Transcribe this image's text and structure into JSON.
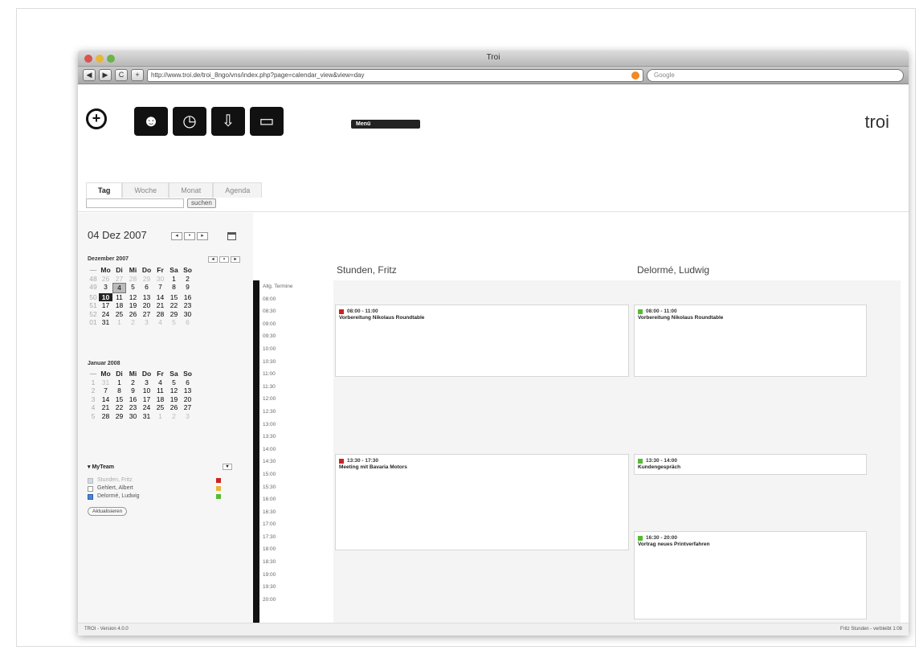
{
  "window": {
    "title": "Troi",
    "url": "http://www.troi.de/troi_8ngo/vns/index.php?page=calendar_view&view=day",
    "search_placeholder": "Google"
  },
  "toolbar": {
    "back": "◀",
    "forward": "▶",
    "reload": "C",
    "add": "+"
  },
  "app": {
    "logo": "troi",
    "pill_label": "Menü"
  },
  "tabs": [
    "Tag",
    "Woche",
    "Monat",
    "Agenda"
  ],
  "search": {
    "button": "suchen"
  },
  "sidebar": {
    "date_heading": "04 Dez 2007",
    "cal1": {
      "title": "Dezember 2007",
      "head": [
        "Mo",
        "Di",
        "Mi",
        "Do",
        "Fr",
        "Sa",
        "So"
      ],
      "weeks": [
        {
          "wk": "48",
          "days": [
            "26",
            "27",
            "28",
            "29",
            "30",
            "1",
            "2"
          ]
        },
        {
          "wk": "49",
          "days": [
            "3",
            "4",
            "5",
            "6",
            "7",
            "8",
            "9"
          ]
        },
        {
          "wk": "50",
          "days": [
            "10",
            "11",
            "12",
            "13",
            "14",
            "15",
            "16"
          ]
        },
        {
          "wk": "51",
          "days": [
            "17",
            "18",
            "19",
            "20",
            "21",
            "22",
            "23"
          ]
        },
        {
          "wk": "52",
          "days": [
            "24",
            "25",
            "26",
            "27",
            "28",
            "29",
            "30"
          ]
        },
        {
          "wk": "01",
          "days": [
            "31",
            "1",
            "2",
            "3",
            "4",
            "5",
            "6"
          ]
        }
      ]
    },
    "cal2": {
      "title": "Januar 2008",
      "head": [
        "Mo",
        "Di",
        "Mi",
        "Do",
        "Fr",
        "Sa",
        "So"
      ],
      "weeks": [
        {
          "wk": "1",
          "days": [
            "31",
            "1",
            "2",
            "3",
            "4",
            "5",
            "6"
          ]
        },
        {
          "wk": "2",
          "days": [
            "7",
            "8",
            "9",
            "10",
            "11",
            "12",
            "13"
          ]
        },
        {
          "wk": "3",
          "days": [
            "14",
            "15",
            "16",
            "17",
            "18",
            "19",
            "20"
          ]
        },
        {
          "wk": "4",
          "days": [
            "21",
            "22",
            "23",
            "24",
            "25",
            "26",
            "27"
          ]
        },
        {
          "wk": "5",
          "days": [
            "28",
            "29",
            "30",
            "31",
            "1",
            "2",
            "3"
          ]
        }
      ]
    },
    "team": {
      "title": "MyTeam",
      "members": [
        {
          "name": "Stunden, Fritz",
          "color": "#cc2222"
        },
        {
          "name": "Gehlert, Albert",
          "color": "#e8b63b"
        },
        {
          "name": "Delormé, Ludwig",
          "color": "#55bb33"
        }
      ],
      "button": "Aktualisieren"
    }
  },
  "times": [
    "Allg. Termine",
    "08:00",
    "08:30",
    "09:00",
    "09:30",
    "10:00",
    "10:30",
    "11:00",
    "11:30",
    "12:00",
    "12:30",
    "13:00",
    "13:30",
    "14:00",
    "14:30",
    "15:00",
    "15:30",
    "16:00",
    "16:30",
    "17:00",
    "17:30",
    "18:00",
    "18:30",
    "19:00",
    "19:30",
    "20:00"
  ],
  "columns": [
    {
      "name": "Stunden, Fritz"
    },
    {
      "name": "Delormé, Ludwig"
    }
  ],
  "events": [
    {
      "time": "08:00 - 11:00",
      "title": "Vorbereitung Nikolaus Roundtable",
      "color": "#cc2222"
    },
    {
      "time": "13:30 - 17:30",
      "title": "Meeting mit Bavaria Motors",
      "color": "#cc2222"
    },
    {
      "time": "08:00 - 11:00",
      "title": "Vorbereitung Nikolaus Roundtable",
      "color": "#55bb33"
    },
    {
      "time": "13:30 - 14:00",
      "title": "Kundengespräch",
      "color": "#55bb33"
    },
    {
      "time": "16:30 - 20:00",
      "title": "Vortrag neues Printverfahren",
      "color": "#55bb33"
    }
  ],
  "status": {
    "left": "TROI - Version 4.0.0",
    "right": "Fritz Stunden - verbleibt 1:08"
  }
}
